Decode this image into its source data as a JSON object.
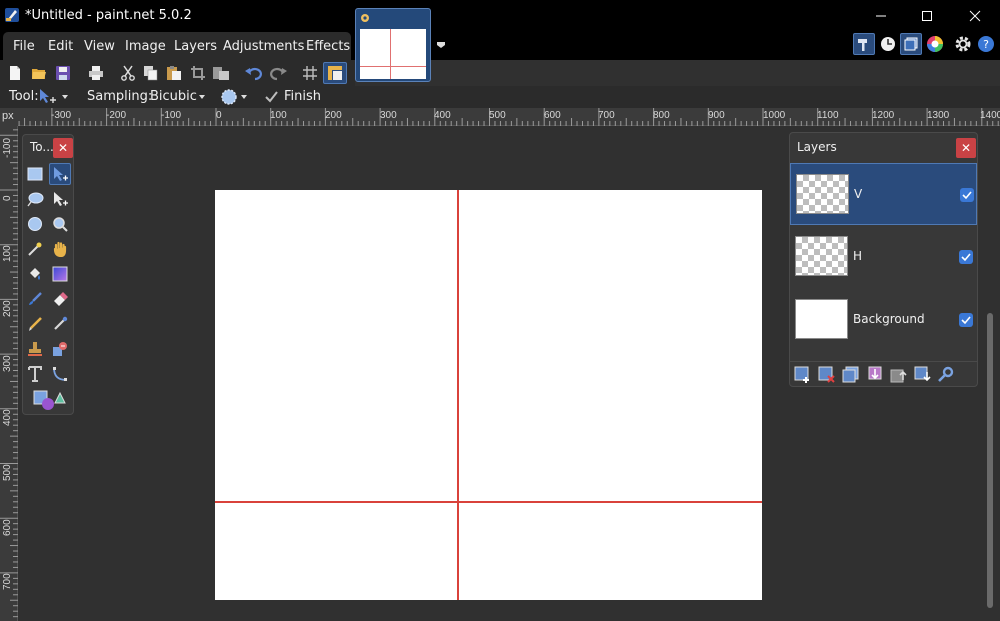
{
  "window": {
    "title": "*Untitled - paint.net 5.0.2",
    "minimize_glyph": "—",
    "maximize_glyph": "☐",
    "close_glyph": "✕"
  },
  "menu": {
    "items": [
      "File",
      "Edit",
      "View",
      "Image",
      "Layers",
      "Adjustments",
      "Effects"
    ]
  },
  "toolbar": {
    "icons": [
      "new-file-icon",
      "open-file-icon",
      "save-icon",
      "print-icon",
      "cut-icon",
      "copy-icon",
      "paste-icon",
      "crop-icon",
      "paste-new-icon",
      "undo-icon",
      "redo-icon",
      "grid-icon",
      "ruler-icon"
    ]
  },
  "options": {
    "tool_label": "Tool:",
    "sampling_label": "Sampling:",
    "sampling_value": "Bicubic",
    "finish_label": "Finish"
  },
  "rulers": {
    "unit": "px",
    "horizontal": [
      "-300",
      "-200",
      "-100",
      "0",
      "100",
      "200",
      "300",
      "400",
      "500",
      "600",
      "700",
      "800",
      "900",
      "1000",
      "1100",
      "1200",
      "1300",
      "1400"
    ],
    "vertical": [
      "-100",
      "0",
      "100",
      "200",
      "300",
      "400",
      "500",
      "600",
      "700"
    ]
  },
  "tools_panel": {
    "title": "To...",
    "close_glyph": "✕"
  },
  "layers_panel": {
    "title": "Layers",
    "close_glyph": "✕",
    "layers": [
      {
        "name": "V",
        "selected": true,
        "visible": true
      },
      {
        "name": "H",
        "selected": false,
        "visible": true
      },
      {
        "name": "Background",
        "selected": false,
        "visible": true
      }
    ]
  },
  "colors": {
    "guide": "#d9423b",
    "accent": "#2a4b7c",
    "checkbox": "#3a78d6",
    "close_button": "#c94245"
  }
}
